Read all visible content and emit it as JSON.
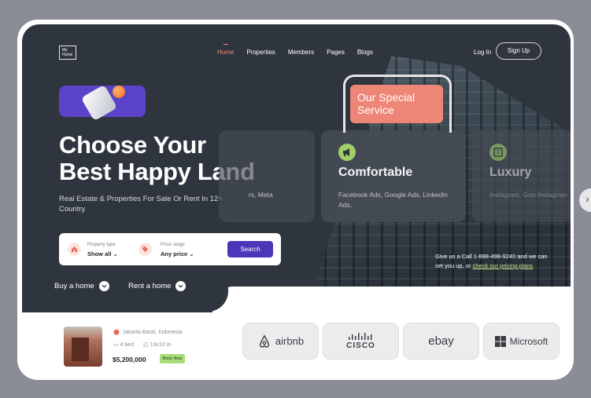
{
  "header": {
    "logo_text": "My Home",
    "nav": [
      {
        "label": "Home",
        "active": true
      },
      {
        "label": "Properties"
      },
      {
        "label": "Members"
      },
      {
        "label": "Pages"
      },
      {
        "label": "Blogs"
      }
    ],
    "login_label": "Log In",
    "signup_label": "Sign Up"
  },
  "hero": {
    "headline_line1": "Choose Your",
    "headline_line2": "Best Happy Land",
    "subtitle": "Real Estate & Properties For Sale Or Rent In 12+ Country",
    "search": {
      "type_label": "Property type",
      "type_value": "Show all",
      "price_label": "Price range",
      "price_value": "Any price",
      "button_label": "Search"
    },
    "buy_label": "Buy a home",
    "rent_label": "Rent a home"
  },
  "services": {
    "badge": "Our Special Service",
    "cards": [
      {
        "title": "",
        "text": "rs, Meta"
      },
      {
        "title": "Comfortable",
        "text": "Facebook Ads, Google Ads, Linkedin Ads,"
      },
      {
        "title": "Luxury",
        "text": "Instagram, Goo Instagram"
      }
    ],
    "call_text": "Give us a Call 1-888-498-9240 and we can set you up, or",
    "call_link": "check our pricing plans"
  },
  "listing": {
    "location": "Jakarta Barat, Indonesia",
    "beds": "4 bed",
    "size": "13x10 m",
    "price": "$5,200,000",
    "book_label": "Book Now"
  },
  "brands": [
    {
      "name": "airbnb",
      "icon": "airbnb-logo"
    },
    {
      "name": "CISCO",
      "icon": "cisco-logo"
    },
    {
      "name": "ebay",
      "icon": "ebay-logo"
    },
    {
      "name": "Microsoft",
      "icon": "microsoft-logo"
    }
  ],
  "colors": {
    "hero_bg": "#2f353f",
    "accent_purple": "#4b35b8",
    "accent_coral": "#ee8677",
    "accent_green": "#a5d86a",
    "nav_active": "#f08a74"
  }
}
